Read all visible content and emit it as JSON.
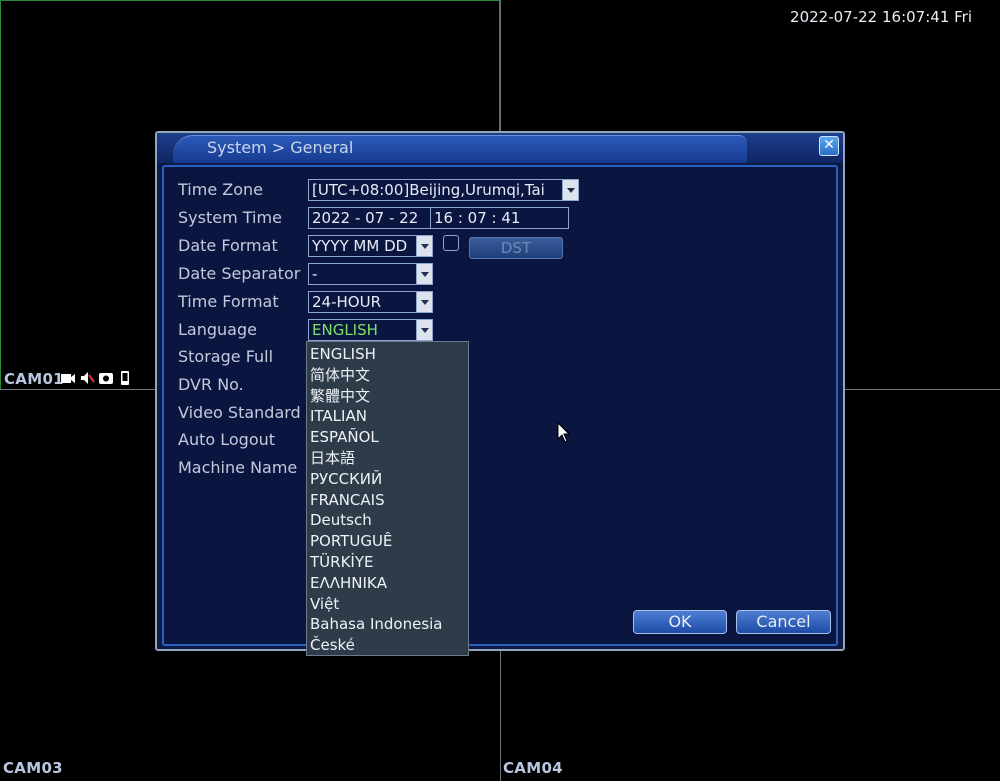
{
  "screen": {
    "datetime": "2022-07-22 16:07:41 Fri",
    "cameras": [
      {
        "label": "CAM01"
      },
      {
        "label": "CAM03"
      },
      {
        "label": "CAM04"
      }
    ],
    "cam01_status_icons": [
      "camera-icon",
      "mute-icon",
      "record-icon",
      "phone-icon"
    ]
  },
  "dialog": {
    "title": "System > General",
    "close_icon": "close-icon",
    "fields": {
      "time_zone": {
        "label": "Time Zone",
        "value": "[UTC+08:00]Beijing,Urumqi,Tai"
      },
      "system_time": {
        "label": "System Time",
        "date": "2022  - 07 - 22",
        "time": "16 : 07 : 41"
      },
      "date_format": {
        "label": "Date Format",
        "value": "YYYY MM DD"
      },
      "date_separator": {
        "label": "Date Separator",
        "value": "-"
      },
      "time_format": {
        "label": "Time Format",
        "value": "24-HOUR"
      },
      "language": {
        "label": "Language",
        "value": "ENGLISH"
      },
      "storage_full": {
        "label": "Storage Full"
      },
      "dvr_no": {
        "label": "DVR No."
      },
      "video_standard": {
        "label": "Video Standard"
      },
      "auto_logout": {
        "label": "Auto Logout"
      },
      "machine_name": {
        "label": "Machine Name"
      }
    },
    "dst_label": "DST",
    "ok_label": "OK",
    "cancel_label": "Cancel"
  },
  "language_options": [
    "ENGLISH",
    "简体中文",
    "繁體中文",
    "ITALIAN",
    "ESPAÑOL",
    "日本語",
    "РУССКИЙ",
    "FRANCAIS",
    "Deutsch",
    "PORTUGUÊ",
    "TÜRKİYE",
    "ΕΛΛΗΝΙΚΑ",
    "Việt",
    "Bahasa Indonesia",
    "České"
  ],
  "colors": {
    "language_value": "#7ee06a",
    "dialog_bg": "#0c1a44",
    "accent": "#2c5fc2"
  }
}
